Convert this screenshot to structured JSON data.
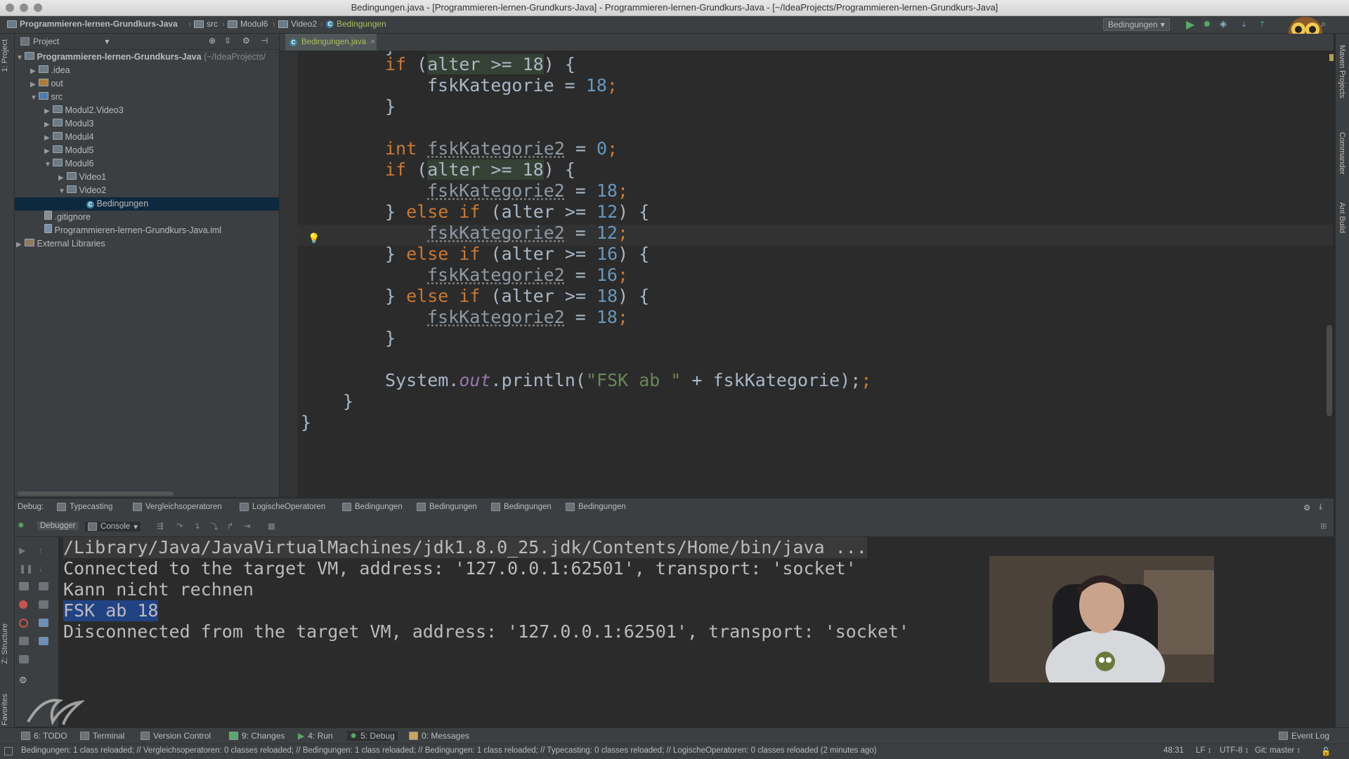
{
  "window": {
    "title": "Bedingungen.java - [Programmieren-lernen-Grundkurs-Java] - Programmieren-lernen-Grundkurs-Java - [~/IdeaProjects/Programmieren-lernen-Grundkurs-Java]"
  },
  "navbar": {
    "crumbs": [
      "Programmieren-lernen-Grundkurs-Java",
      "src",
      "Modul6",
      "Video2",
      "Bedingungen"
    ],
    "run_config": "Bedingungen"
  },
  "left_stripe": {
    "project_tab": "1: Project",
    "structure_tab": "Z: Structure",
    "favorites_tab": "2: Favorites"
  },
  "right_stripe": {
    "maven_tab": "Maven Projects",
    "commander_tab": "Commander",
    "ant_tab": "Ant Build"
  },
  "project": {
    "header": "Project",
    "root_label": "Programmieren-lernen-Grundkurs-Java",
    "root_path": "(~/IdeaProjects/",
    "items": [
      {
        "label": ".idea"
      },
      {
        "label": "out"
      },
      {
        "label": "src"
      },
      {
        "label": "Modul2.Video3"
      },
      {
        "label": "Modul3"
      },
      {
        "label": "Modul4"
      },
      {
        "label": "Modul5"
      },
      {
        "label": "Modul6"
      },
      {
        "label": "Video1"
      },
      {
        "label": "Video2"
      },
      {
        "label": "Bedingungen"
      },
      {
        "label": ".gitignore"
      },
      {
        "label": "Programmieren-lernen-Grundkurs-Java.iml"
      },
      {
        "label": "External Libraries"
      }
    ]
  },
  "editor": {
    "tab_label": "Bedingungen.java",
    "code": {
      "l1": "}",
      "if_kw": "if",
      "alter_ge_18": "alter >= 18",
      "open_brace": ") {",
      "fsk_assign": "fskKategorie = ",
      "eighteen": "18",
      "semi": ";",
      "int_kw": "int",
      "fsk2": "fskKategorie2",
      "eq": " = ",
      "zero": "0",
      "else_if": "else if",
      "alter_ge": "(alter >= ",
      "twelve": "12",
      "sixteen": "16",
      "sysout_a": "System.",
      "sysout_out": "out",
      "sysout_b": ".println(",
      "fsk_str": "\"FSK ab \"",
      "sysout_c": " + fskKategorie);",
      "close_method": "}",
      "close_class": "}"
    }
  },
  "debug": {
    "label": "Debug:",
    "tabs": [
      "Typecasting",
      "Vergleichsoperatoren",
      "LogischeOperatoren",
      "Bedingungen",
      "Bedingungen",
      "Bedingungen",
      "Bedingungen"
    ],
    "debugger_tab": "Debugger",
    "console_tab": "Console",
    "console_lines": [
      "/Library/Java/JavaVirtualMachines/jdk1.8.0_25.jdk/Contents/Home/bin/java ...",
      "Connected to the target VM, address: '127.0.0.1:62501', transport: 'socket'",
      "Kann nicht rechnen",
      "FSK ab 18",
      "Disconnected from the target VM, address: '127.0.0.1:62501', transport: 'socket'"
    ]
  },
  "bottom_tools": [
    {
      "label": "6: TODO"
    },
    {
      "label": "Terminal"
    },
    {
      "label": "Version Control"
    },
    {
      "label": "9: Changes"
    },
    {
      "label": "4: Run"
    },
    {
      "label": "5: Debug"
    },
    {
      "label": "0: Messages"
    }
  ],
  "event_log": "Event Log",
  "status": {
    "message": "Bedingungen: 1 class reloaded; // Vergleichsoperatoren: 0 classes reloaded; // Bedingungen: 1 class reloaded; // Bedingungen: 1 class reloaded; // Typecasting: 0 classes reloaded; // LogischeOperatoren: 0 classes reloaded (2 minutes ago)",
    "position": "48:31",
    "line_sep": "LF ↕",
    "encoding": "UTF-8 ↕",
    "vcs": "Git: master ↕"
  },
  "colors": {
    "keyword": "#cc7832",
    "number": "#6897bb",
    "string": "#6a8759",
    "field": "#9876aa",
    "selection": "#214283"
  }
}
